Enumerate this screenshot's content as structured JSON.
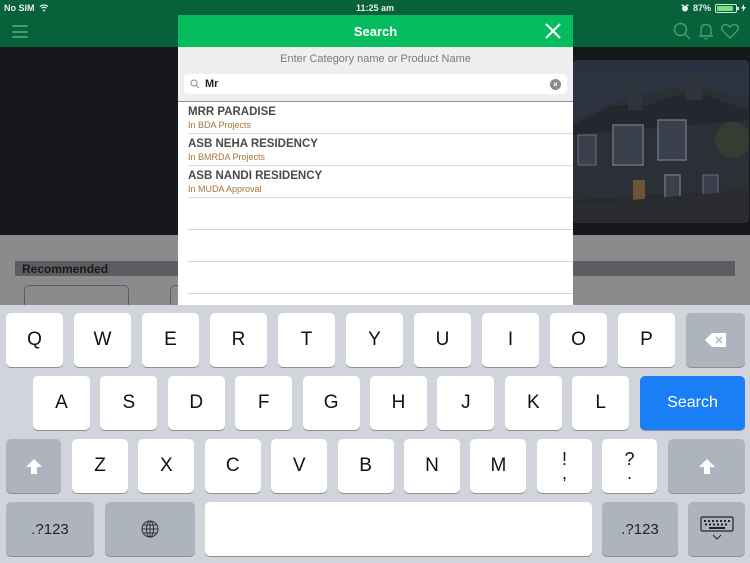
{
  "status_bar": {
    "carrier": "No SIM",
    "time": "11:25 am",
    "battery_percent_label": "87%",
    "battery_level": 0.87
  },
  "app_header": {
    "icons": [
      "menu-icon",
      "search-icon",
      "bell-icon",
      "heart-icon"
    ]
  },
  "content": {
    "section_title": "Recommended"
  },
  "search_modal": {
    "title": "Search",
    "hint": "Enter Category name or Product Name",
    "input_value": "Mr",
    "clear_label": "×",
    "results": [
      {
        "name": "MRR PARADISE",
        "category": "In BDA Projects"
      },
      {
        "name": "ASB NEHA RESIDENCY",
        "category": "In BMRDA Projects"
      },
      {
        "name": "ASB NANDI RESIDENCY",
        "category": "In MUDA Approval"
      }
    ]
  },
  "keyboard": {
    "row1": [
      "Q",
      "W",
      "E",
      "R",
      "T",
      "Y",
      "U",
      "I",
      "O",
      "P"
    ],
    "row2": [
      "A",
      "S",
      "D",
      "F",
      "G",
      "H",
      "J",
      "K",
      "L"
    ],
    "row3": [
      "Z",
      "X",
      "C",
      "V",
      "B",
      "N",
      "M"
    ],
    "punct1": {
      "top": "!",
      "bottom": ","
    },
    "punct2": {
      "top": "?",
      "bottom": "."
    },
    "search_label": "Search",
    "numbers_label": ".?123"
  },
  "colors": {
    "header_green_dimmed": "#07613a",
    "modal_green": "#05bc5e",
    "category_text": "#a8723f",
    "search_key_blue": "#1a7ef6"
  }
}
